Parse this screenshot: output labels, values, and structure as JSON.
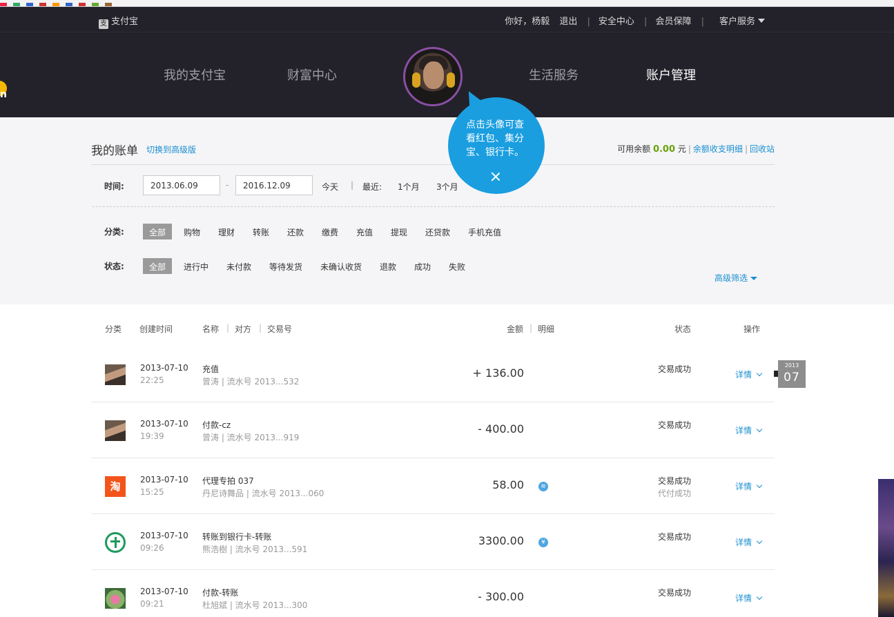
{
  "topbar": {
    "brand": "支付宝",
    "greeting": "你好，杨毅",
    "logout": "退出",
    "security": "安全中心",
    "membership": "会员保障",
    "service": "客户服务"
  },
  "nav": {
    "items": [
      "我的支付宝",
      "财富中心",
      "生活服务",
      "账户管理"
    ]
  },
  "bubble": {
    "line1": "点击头像可查",
    "line2": "看红包、集分",
    "line3": "宝、银行卡。"
  },
  "bill": {
    "title": "我的账单",
    "switch": "切换到高级版",
    "balance_label": "可用余额",
    "balance": "0.00",
    "balance_unit": "元",
    "detail_link": "余额收支明细",
    "recycle_link": "回收站"
  },
  "filters": {
    "time_label": "时间:",
    "date_from": "2013.06.09",
    "date_to": "2016.12.09",
    "date_sep": "-",
    "today": "今天",
    "recent_label": "最近:",
    "recent_1m": "1个月",
    "recent_3m": "3个月",
    "category_label": "分类:",
    "categories": [
      "全部",
      "购物",
      "理财",
      "转账",
      "还款",
      "缴费",
      "充值",
      "提现",
      "还贷款",
      "手机充值"
    ],
    "status_label": "状态:",
    "statuses": [
      "全部",
      "进行中",
      "未付款",
      "等待发货",
      "未确认收货",
      "退款",
      "成功",
      "失败"
    ],
    "advanced": "高级筛选"
  },
  "table": {
    "headers": {
      "category": "分类",
      "created": "创建时间",
      "name": "名称",
      "party": "对方",
      "trade_no": "交易号",
      "amount": "金额",
      "detail": "明细",
      "status": "状态",
      "action": "操作"
    },
    "rows": [
      {
        "date": "2013-07-10",
        "time": "22:25",
        "name": "充值",
        "sub": "曾涛 | 流水号 2013...532",
        "amount": "+ 136.00",
        "status": "交易成功",
        "status2": "",
        "action": "详情",
        "icon": "avatar-icon"
      },
      {
        "date": "2013-07-10",
        "time": "19:39",
        "name": "付款-cz",
        "sub": "曾涛 | 流水号 2013...919",
        "amount": "- 400.00",
        "status": "交易成功",
        "status2": "",
        "action": "详情",
        "icon": "avatar-icon"
      },
      {
        "date": "2013-07-10",
        "time": "15:25",
        "name": "代理专拍 037",
        "sub": "丹尼诗舞品 | 流水号 2013...060",
        "amount": "58.00",
        "status": "交易成功",
        "status2": "代付成功",
        "action": "详情",
        "icon": "taobao-icon",
        "icon_text": "淘"
      },
      {
        "date": "2013-07-10",
        "time": "09:26",
        "name": "转账到银行卡-转账",
        "sub": "熊浩樹 | 流水号 2013...591",
        "amount": "3300.00",
        "status": "交易成功",
        "status2": "",
        "action": "详情",
        "icon": "bank-icon"
      },
      {
        "date": "2013-07-10",
        "time": "09:21",
        "name": "付款-转账",
        "sub": "杜旭斌 | 流水号 2013...300",
        "amount": "- 300.00",
        "status": "交易成功",
        "status2": "",
        "action": "详情",
        "icon": "lotus-avatar-icon"
      }
    ]
  },
  "stamp": {
    "year": "2013",
    "month": "07"
  },
  "left_edge_label": "n",
  "colors": {
    "accent": "#1a8fd0",
    "bubble": "#1a9ee0",
    "header": "#23222a",
    "balance": "#6aa20a"
  }
}
